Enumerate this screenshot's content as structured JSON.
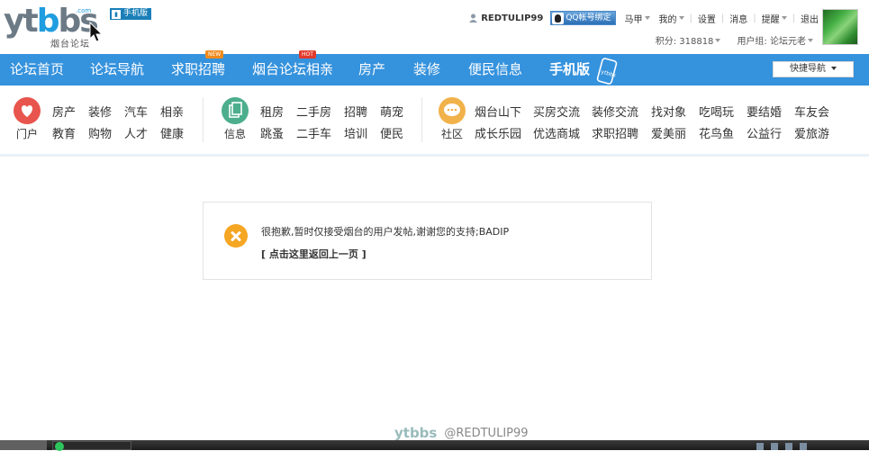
{
  "header": {
    "logo_text_a": "yt",
    "logo_text_o": "b",
    "logo_text_b": "bs",
    "logo_com": ".com",
    "logo_sub": "烟台论坛",
    "mobile_btn": "手机版",
    "username": "REDTULIP99",
    "qq_btn": "QQ帐号绑定",
    "menu": [
      "马甲",
      "我的",
      "设置",
      "消息",
      "提醒",
      "退出"
    ],
    "points": "积分: 318818",
    "user_group": "用户组: 论坛元老"
  },
  "nav": {
    "items": [
      "论坛首页",
      "论坛导航",
      "求职招聘",
      "烟台论坛相亲",
      "房产",
      "装修",
      "便民信息",
      "手机版"
    ],
    "badge_new": "NEW",
    "badge_hot": "HOT",
    "quick_nav": "快捷导航"
  },
  "categories": [
    {
      "label": "门户",
      "links": [
        "房产",
        "装修",
        "汽车",
        "相亲",
        "教育",
        "购物",
        "人才",
        "健康"
      ],
      "color": "#e8554e"
    },
    {
      "label": "信息",
      "links": [
        "租房",
        "二手房",
        "招聘",
        "萌宠",
        "跳蚤",
        "二手车",
        "培训",
        "便民"
      ],
      "color": "#4cae8c"
    },
    {
      "label": "社区",
      "links": [
        "烟台山下",
        "买房交流",
        "装修交流",
        "找对象",
        "吃喝玩",
        "要结婚",
        "车友会",
        "成长乐园",
        "优选商城",
        "求职招聘",
        "爱美丽",
        "花鸟鱼",
        "公益行",
        "爱旅游"
      ],
      "color": "#f1b24a"
    }
  ],
  "message": {
    "text": "很抱歉,暂时仅接受烟台的用户发帖,谢谢您的支持;BADIP",
    "link": "[ 点击这里返回上一页 ]"
  },
  "watermark": {
    "logo": "ytbbs",
    "handle": "@REDTULIP99"
  }
}
